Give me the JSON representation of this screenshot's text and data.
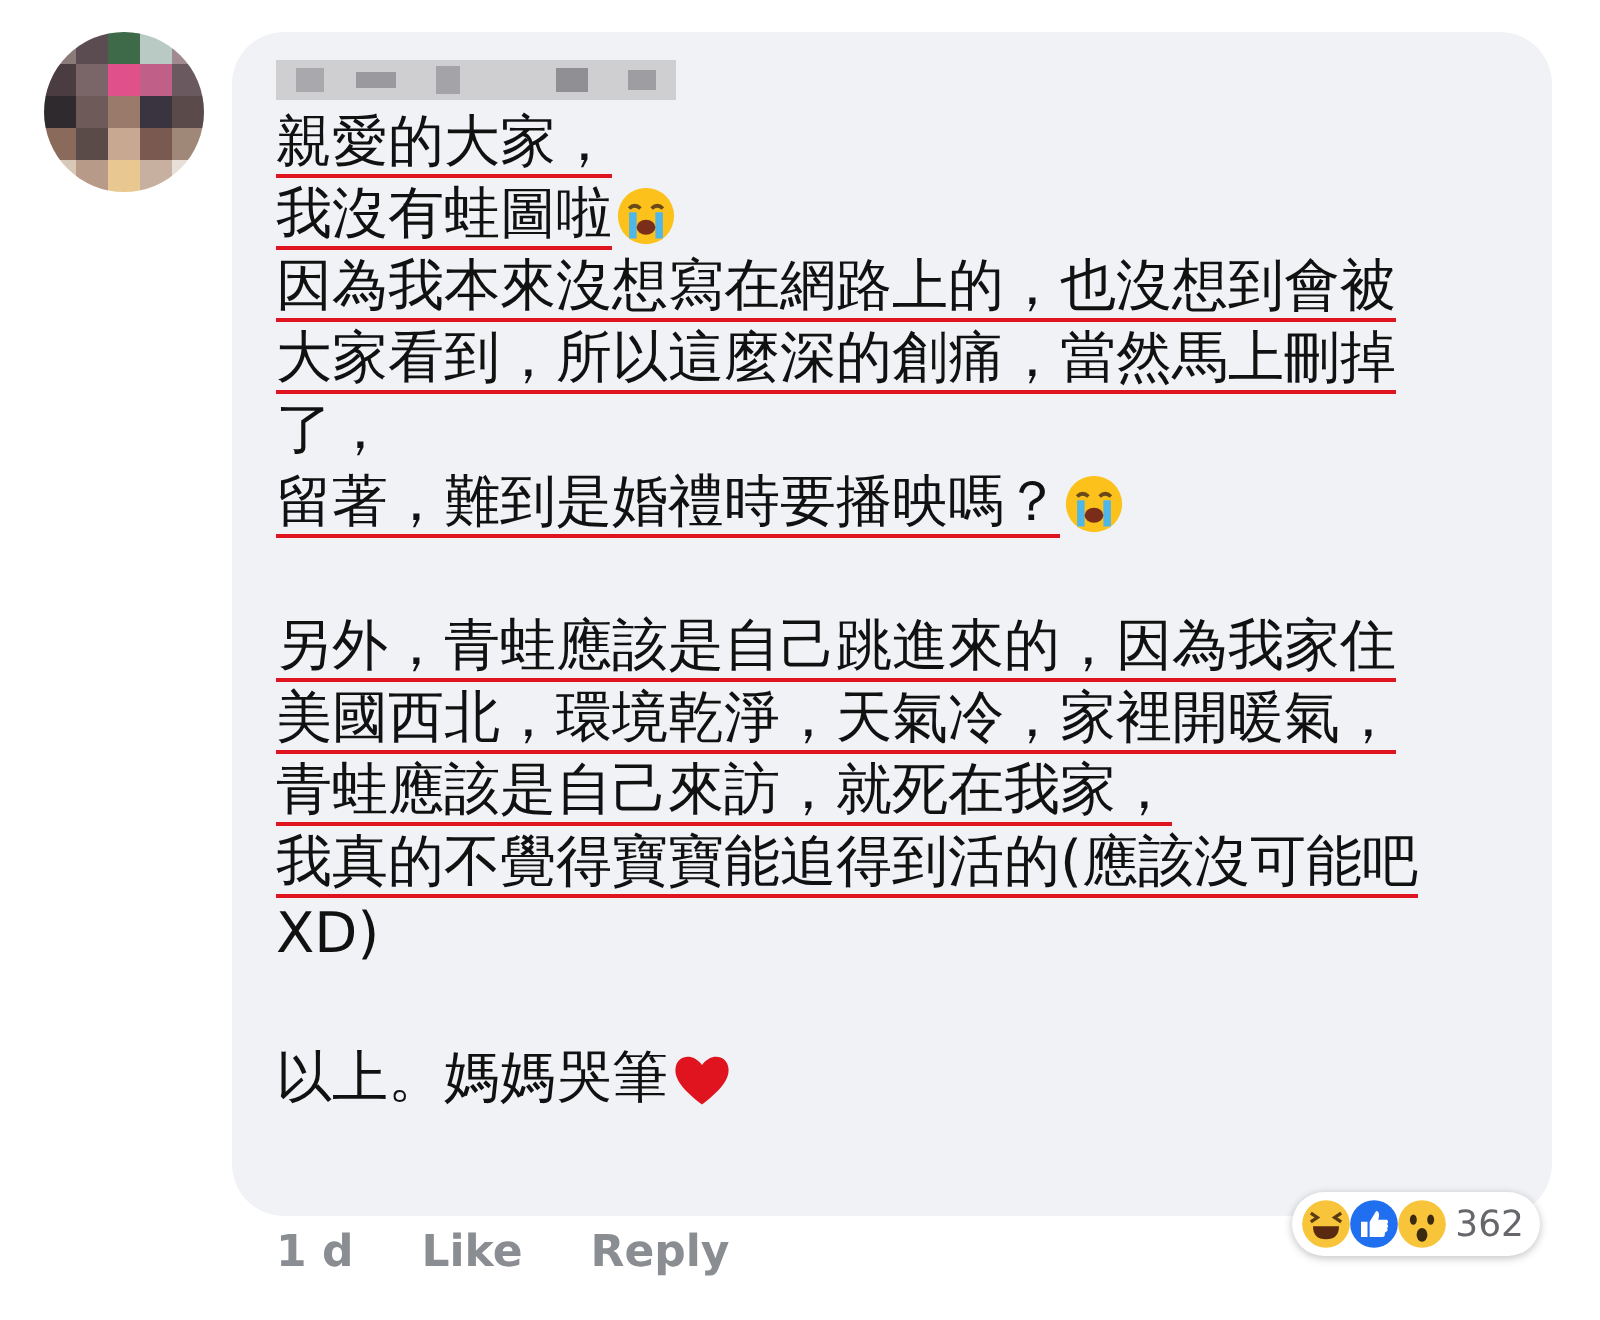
{
  "comment": {
    "paragraphs": [
      [
        {
          "text": "親愛的大家，",
          "underlined": true
        },
        {
          "text": "我沒有蛙圖啦",
          "underlined": true,
          "icon": {
            "kind": "crying"
          }
        },
        {
          "text": "因為我本來沒想寫在網路上的，也沒想到會被",
          "underlined": true
        },
        {
          "text": "大家看到，所以這麼深的創痛，當然馬上刪掉",
          "underlined": true
        },
        {
          "text": "了，",
          "underlined": false
        },
        {
          "text": "留著，難到是婚禮時要播映嗎？",
          "underlined": true,
          "icon": {
            "kind": "crying"
          }
        }
      ],
      [
        {
          "text": "另外，青蛙應該是自己跳進來的，因為我家住",
          "underlined": true
        },
        {
          "text": "美國西北，環境乾淨，天氣冷，家裡開暖氣，",
          "underlined": true
        },
        {
          "text": "青蛙應該是自己來訪，就死在我家，",
          "underlined": true
        },
        {
          "text": "我真的不覺得寶寶能追得到活的(應該沒可能吧",
          "underlined": true
        },
        {
          "text": "XD)",
          "underlined": false
        }
      ],
      [
        {
          "text": "以上。媽媽哭筆",
          "underlined": false,
          "icon": {
            "kind": "heart"
          }
        }
      ]
    ],
    "reactions": {
      "icons": [
        {
          "kind": "haha"
        },
        {
          "kind": "like"
        },
        {
          "kind": "wow"
        }
      ],
      "count": "362"
    }
  },
  "actions": [
    "1 d",
    "Like",
    "Reply"
  ]
}
